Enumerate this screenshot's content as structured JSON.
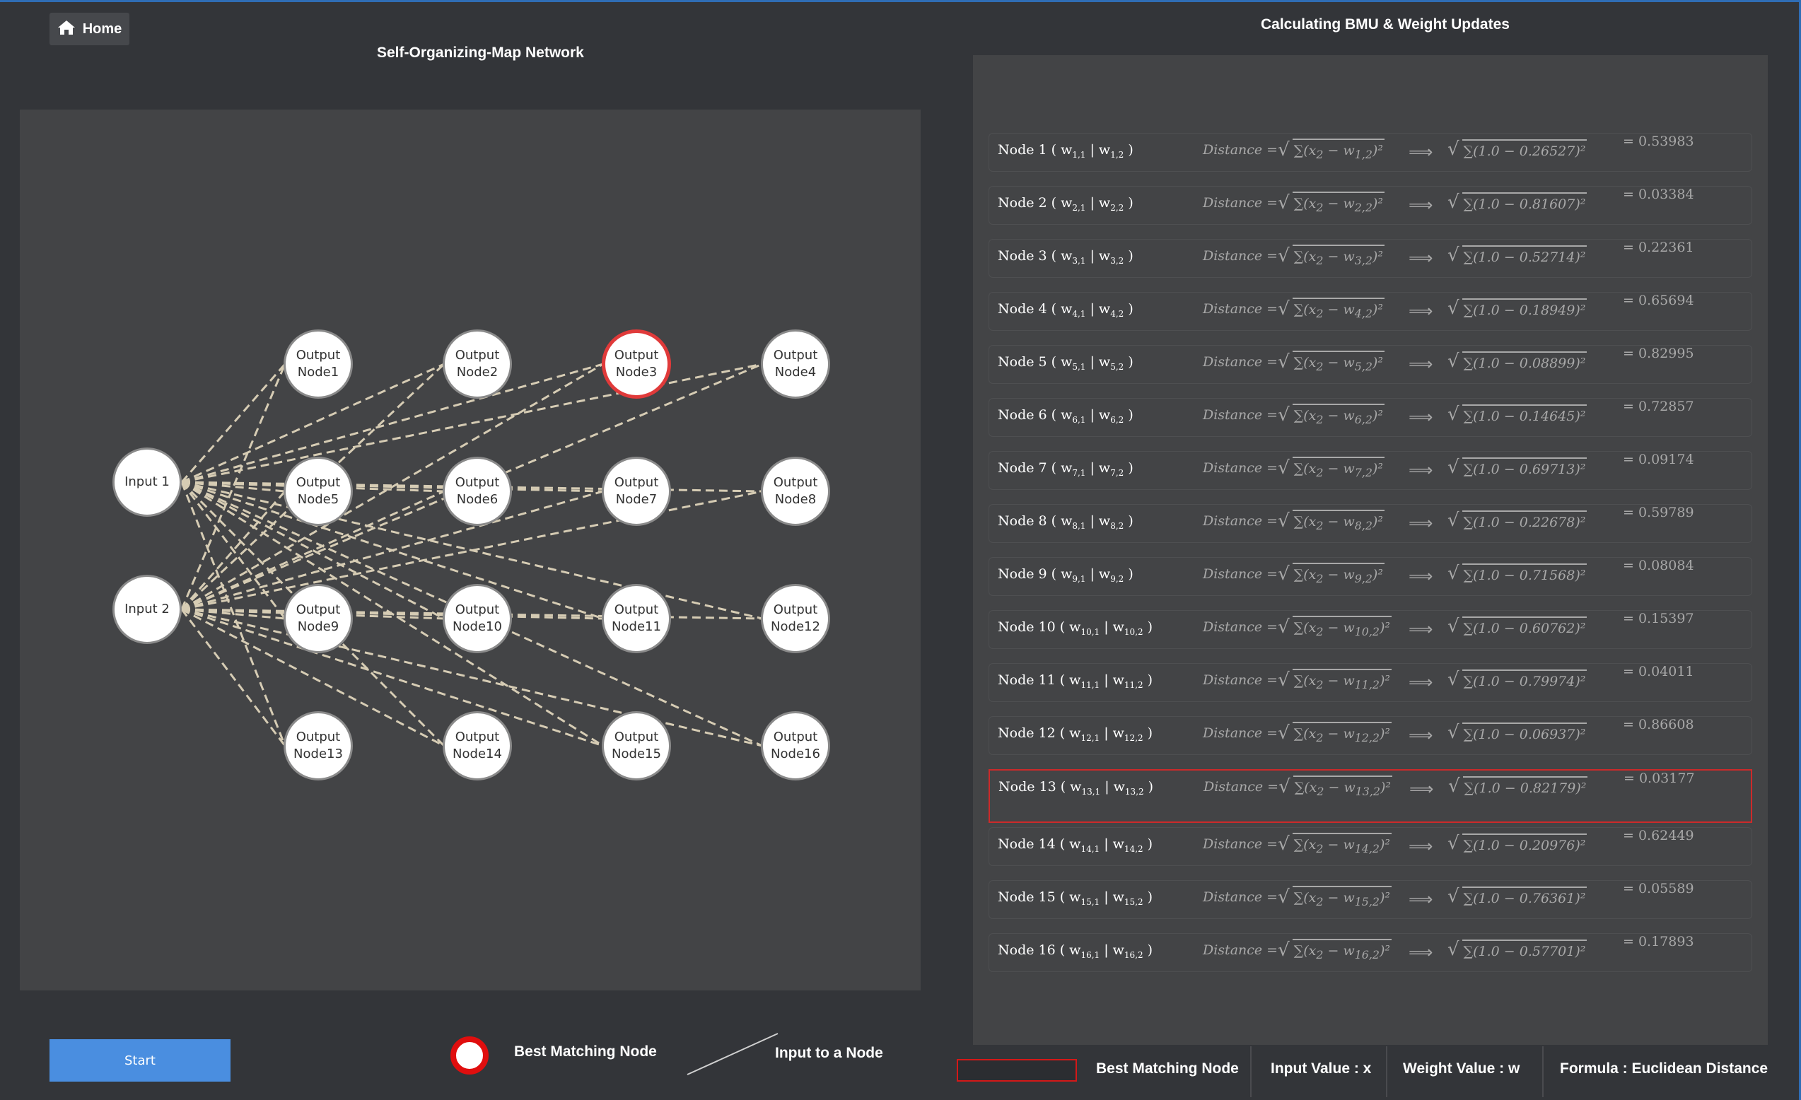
{
  "header": {
    "home_label": "Home",
    "network_title": "Self-Organizing-Map Network",
    "calc_title": "Calculating BMU & Weight Updates"
  },
  "network": {
    "inputs": [
      {
        "label": "Input 1"
      },
      {
        "label": "Input 2"
      }
    ],
    "outputs": [
      {
        "label": "Output\nNode1",
        "bmu": false
      },
      {
        "label": "Output\nNode2",
        "bmu": false
      },
      {
        "label": "Output\nNode3",
        "bmu": true
      },
      {
        "label": "Output\nNode4",
        "bmu": false
      },
      {
        "label": "Output\nNode5",
        "bmu": false
      },
      {
        "label": "Output\nNode6",
        "bmu": false
      },
      {
        "label": "Output\nNode7",
        "bmu": false
      },
      {
        "label": "Output\nNode8",
        "bmu": false
      },
      {
        "label": "Output\nNode9",
        "bmu": false
      },
      {
        "label": "Output\nNode10",
        "bmu": false
      },
      {
        "label": "Output\nNode11",
        "bmu": false
      },
      {
        "label": "Output\nNode12",
        "bmu": false
      },
      {
        "label": "Output\nNode13",
        "bmu": false
      },
      {
        "label": "Output\nNode14",
        "bmu": false
      },
      {
        "label": "Output\nNode15",
        "bmu": false
      },
      {
        "label": "Output\nNode16",
        "bmu": false
      }
    ],
    "edge_color": "#d6ccb4",
    "bmu_color": "#e03a3a"
  },
  "calculations": {
    "formula_prefix": "Distance",
    "rows": [
      {
        "node": "1",
        "weight": "0.26527",
        "result": "= 0.53983",
        "highlight": false
      },
      {
        "node": "2",
        "weight": "0.81607",
        "result": "= 0.03384",
        "highlight": false
      },
      {
        "node": "3",
        "weight": "0.52714",
        "result": "= 0.22361",
        "highlight": false
      },
      {
        "node": "4",
        "weight": "0.18949",
        "result": "= 0.65694",
        "highlight": false
      },
      {
        "node": "5",
        "weight": "0.08899",
        "result": "= 0.82995",
        "highlight": false
      },
      {
        "node": "6",
        "weight": "0.14645",
        "result": "= 0.72857",
        "highlight": false
      },
      {
        "node": "7",
        "weight": "0.69713",
        "result": "= 0.09174",
        "highlight": false
      },
      {
        "node": "8",
        "weight": "0.22678",
        "result": "= 0.59789",
        "highlight": false
      },
      {
        "node": "9",
        "weight": "0.71568",
        "result": "= 0.08084",
        "highlight": false
      },
      {
        "node": "10",
        "weight": "0.60762",
        "result": "= 0.15397",
        "highlight": false
      },
      {
        "node": "11",
        "weight": "0.79974",
        "result": "= 0.04011",
        "highlight": false
      },
      {
        "node": "12",
        "weight": "0.06937",
        "result": "= 0.86608",
        "highlight": false
      },
      {
        "node": "13",
        "weight": "0.82179",
        "result": "= 0.03177",
        "highlight": true
      },
      {
        "node": "14",
        "weight": "0.20976",
        "result": "= 0.62449",
        "highlight": false
      },
      {
        "node": "15",
        "weight": "0.76361",
        "result": "= 0.05589",
        "highlight": false
      },
      {
        "node": "16",
        "weight": "0.57701",
        "result": "= 0.17893",
        "highlight": false
      }
    ]
  },
  "controls": {
    "start_label": "Start"
  },
  "legend": {
    "bmu_circle_label": "Best Matching Node",
    "input_line_label": "Input to a Node",
    "bmu_rect_label": "Best Matching Node",
    "input_value_label": "Input Value : x",
    "weight_value_label": "Weight Value : w",
    "formula_label": "Formula : Euclidean Distance"
  },
  "icons": {
    "home": "home-icon"
  }
}
